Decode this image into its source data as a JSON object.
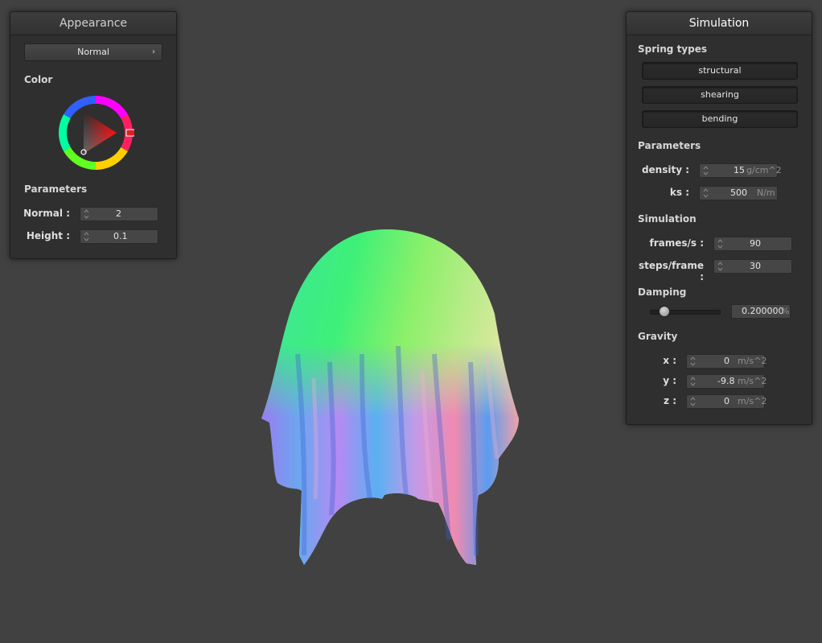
{
  "appearance": {
    "title": "Appearance",
    "shader_select": "Normal",
    "color_label": "Color",
    "parameters_label": "Parameters",
    "normal_label": "Normal :",
    "normal_value": "2",
    "height_label": "Height :",
    "height_value": "0.1",
    "selected_color": "#ff0000"
  },
  "simulation": {
    "title": "Simulation",
    "spring_types_label": "Spring types",
    "springs": [
      "structural",
      "shearing",
      "bending"
    ],
    "parameters_label": "Parameters",
    "density_label": "density :",
    "density_value": "15",
    "density_unit": "g/cm^2",
    "ks_label": "ks :",
    "ks_value": "500",
    "ks_unit": "N/m",
    "simulation_label": "Simulation",
    "fps_label": "frames/s :",
    "fps_value": "90",
    "steps_label": "steps/frame :",
    "steps_value": "30",
    "damping_label": "Damping",
    "damping_value": "0.200000",
    "damping_unit": "%",
    "damping_fraction": 0.2,
    "gravity_label": "Gravity",
    "gx_label": "x :",
    "gx_value": "0",
    "gy_label": "y :",
    "gy_value": "-9.8",
    "gz_label": "z :",
    "gz_value": "0",
    "gravity_unit": "m/s^2"
  },
  "colors": {
    "background": "#414141",
    "panel": "#2f2f2f"
  }
}
